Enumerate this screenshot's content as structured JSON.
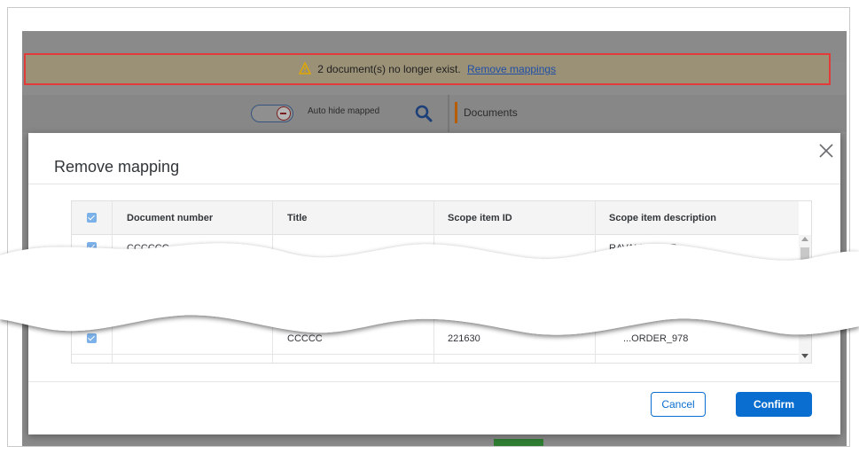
{
  "banner": {
    "message": "2 document(s) no longer exist.",
    "link": "Remove mappings",
    "icon": "warning-icon"
  },
  "toolbar": {
    "auto_hide_label": "Auto hide mapped",
    "documents_label": "Documents"
  },
  "dialog": {
    "title": "Remove mapping",
    "columns": [
      "Document number",
      "Title",
      "Scope item ID",
      "Scope item description"
    ],
    "rows": [
      {
        "checked": true,
        "document_number": "CCCCCC",
        "title": "",
        "scope_item_id": "",
        "scope_item_description": "RAVALIORDER"
      },
      {
        "checked": true,
        "document_number": "",
        "title": "CCCCC",
        "scope_item_id": "221630",
        "scope_item_description": "...ORDER_978"
      }
    ],
    "cancel_label": "Cancel",
    "confirm_label": "Confirm"
  },
  "colors": {
    "primary": "#0a6ed1",
    "banner_border": "#e33a3a",
    "docs_accent": "#b85c00"
  }
}
